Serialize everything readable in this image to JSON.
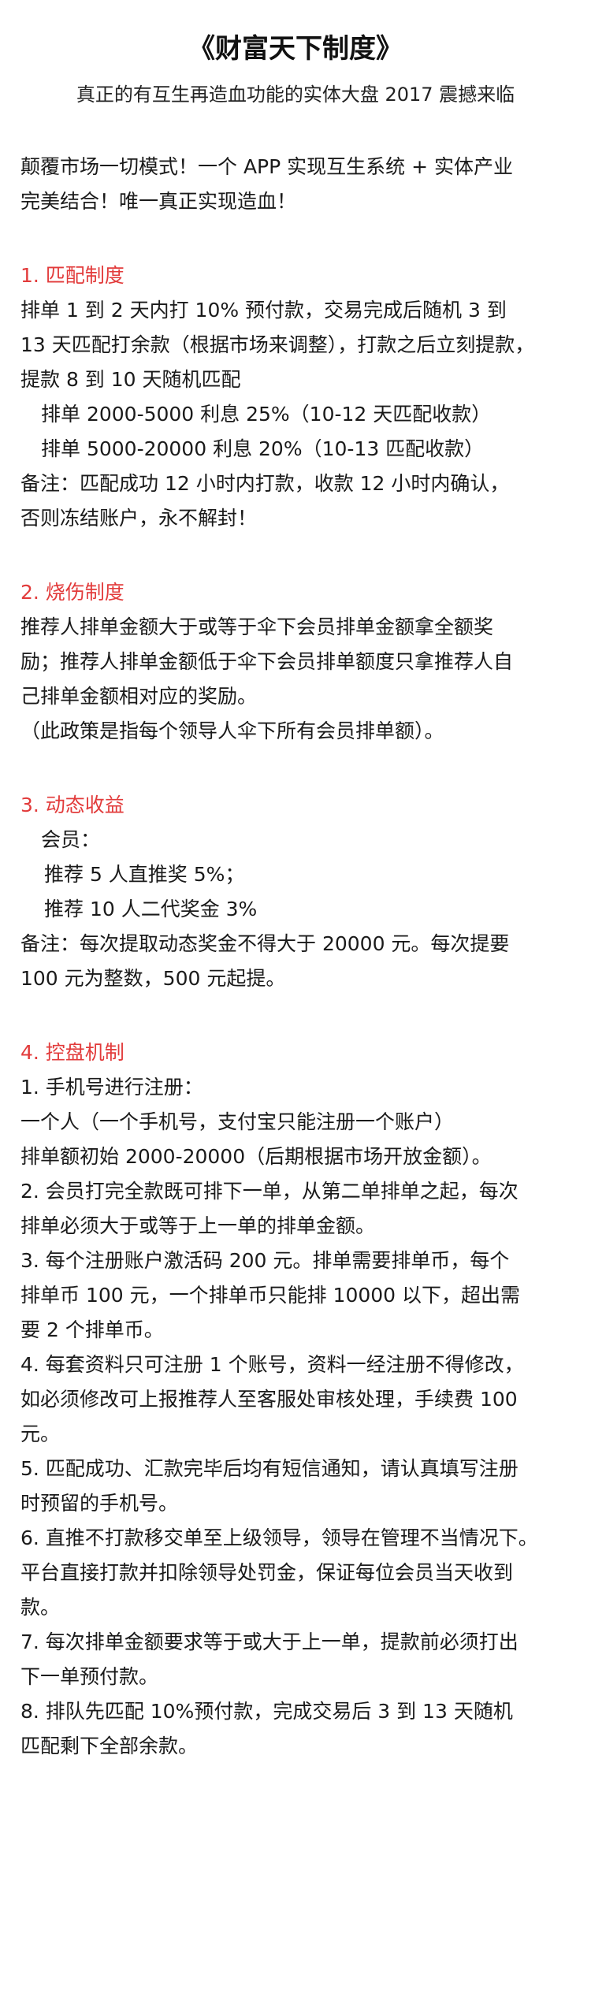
{
  "doc": {
    "title": "《财富天下制度》",
    "subtitle": "真正的有互生再造血功能的实体大盘 2017 震撼来临",
    "intro": [
      "颠覆市场一切模式！一个 APP 实现互生系统 + 实体产业",
      "完美结合！唯一真正实现造血！"
    ]
  },
  "sections": [
    {
      "heading": "1. 匹配制度",
      "lines": [
        "排单 1 到 2 天内打 10% 预付款，交易完成后随机 3 到",
        "13 天匹配打余款（根据市场来调整），打款之后立刻提款，",
        "提款 8 到 10 天随机匹配",
        "排单 2000-5000  利息 25%（10-12 天匹配收款）",
        "排单 5000-20000 利息 20%（10-13 匹配收款）",
        "备注：匹配成功 12 小时内打款，收款 12 小时内确认，",
        "否则冻结账户，永不解封！"
      ]
    },
    {
      "heading": "2. 烧伤制度",
      "lines": [
        "推荐人排单金额大于或等于伞下会员排单金额拿全额奖",
        "励；推荐人排单金额低于伞下会员排单额度只拿推荐人自",
        "己排单金额相对应的奖励。",
        "（此政策是指每个领导人伞下所有会员排单额）。"
      ]
    },
    {
      "heading": "3. 动态收益",
      "lines": [
        "会员：",
        "推荐 5 人直推奖 5%；",
        "推荐 10 人二代奖金 3%",
        "备注：每次提取动态奖金不得大于 20000 元。每次提要",
        "100 元为整数，500 元起提。"
      ]
    },
    {
      "heading": "4. 控盘机制",
      "lines": [
        "1. 手机号进行注册：",
        "一个人（一个手机号，支付宝只能注册一个账户）",
        "排单额初始 2000-20000（后期根据市场开放金额）。",
        "2. 会员打完全款既可排下一单，从第二单排单之起，每次",
        "排单必须大于或等于上一单的排单金额。",
        "3. 每个注册账户激活码 200 元。排单需要排单币，每个",
        "排单币 100 元，一个排单币只能排 10000 以下，超出需",
        "要 2 个排单币。",
        "4. 每套资料只可注册 1 个账号，资料一经注册不得修改，",
        "如必须修改可上报推荐人至客服处审核处理，手续费 100",
        "元。",
        "5. 匹配成功、汇款完毕后均有短信通知，请认真填写注册",
        "时预留的手机号。",
        "6. 直推不打款移交单至上级领导，领导在管理不当情况下。",
        "平台直接打款并扣除领导处罚金，保证每位会员当天收到",
        "款。",
        "7. 每次排单金额要求等于或大于上一单，提款前必须打出",
        "下一单预付款。",
        "8. 排队先匹配 10%预付款，完成交易后 3 到 13 天随机",
        "匹配剩下全部余款。"
      ]
    }
  ],
  "colors": {
    "heading": "#e23b3b",
    "text": "#1a1a1a",
    "background": "#ffffff"
  }
}
